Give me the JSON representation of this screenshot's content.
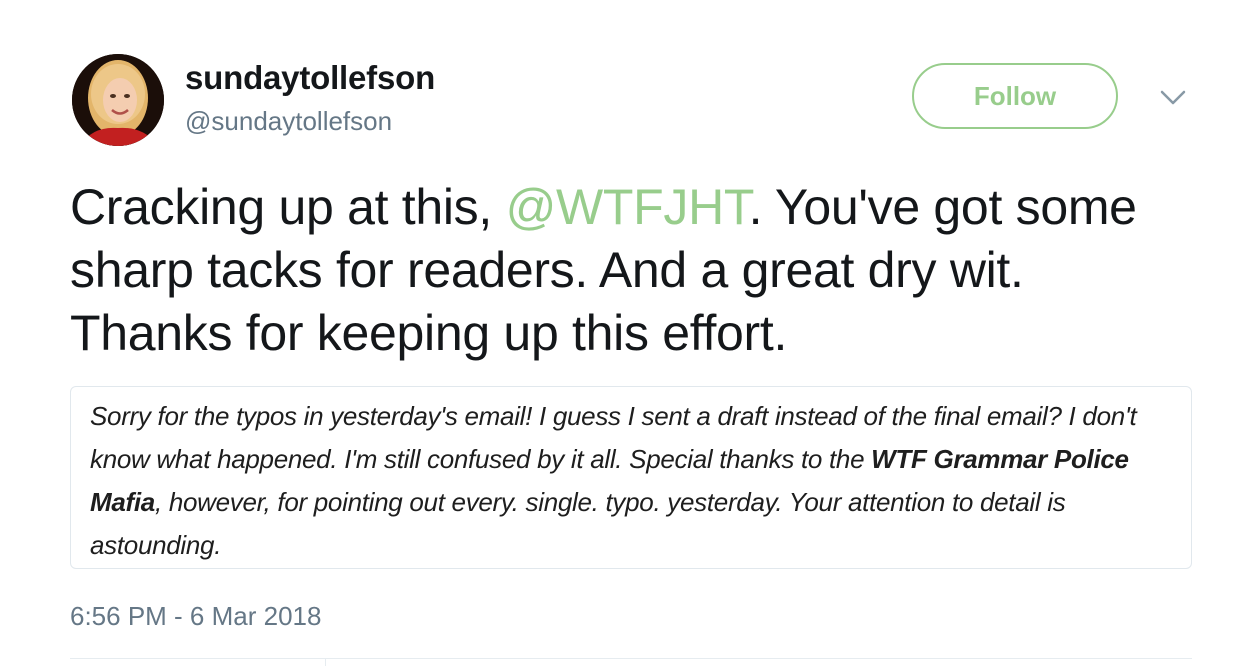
{
  "user": {
    "display_name": "sundaytollefson",
    "handle": "@sundaytollefson"
  },
  "follow_button": {
    "label": "Follow"
  },
  "tweet": {
    "text_before_mention": "Cracking up at this, ",
    "mention": "@WTFJHT",
    "text_after_mention": ". You've got some sharp tacks for readers. And a great dry wit. Thanks for keeping up this effort.",
    "timestamp": "6:56 PM - 6 Mar 2018"
  },
  "attached_image": {
    "text_part1": "Sorry for the typos in yesterday's email! I guess I sent a draft instead of the final email? I don't know what happened. I'm still confused by it all. Special thanks to the ",
    "bold_text": "WTF Grammar Police Mafia",
    "text_part2": ", however, for pointing out every. single. typo. yesterday. Your attention to detail is astounding."
  },
  "colors": {
    "accent": "#98cd8c",
    "secondary_text": "#657786",
    "primary_text": "#14171a",
    "border": "#e1e8ed"
  },
  "icons": {
    "avatar": "profile-photo",
    "menu": "chevron-down-icon"
  }
}
